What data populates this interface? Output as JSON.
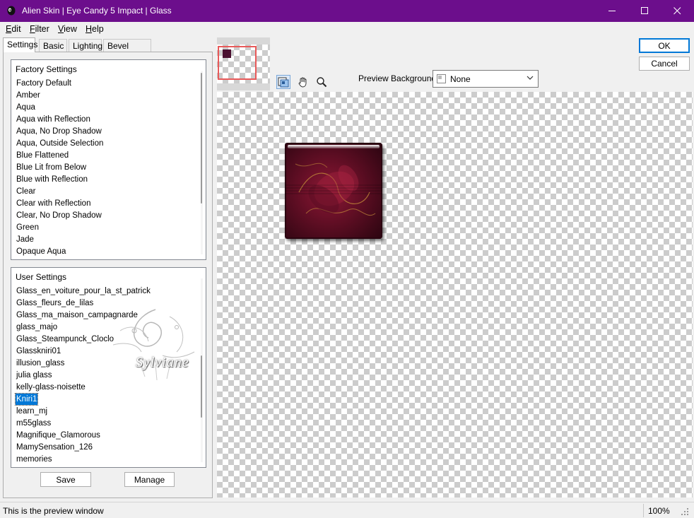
{
  "window": {
    "title": "Alien Skin | Eye Candy 5 Impact | Glass",
    "title_bar_color": "#6c0e8c"
  },
  "menu": [
    "Edit",
    "Filter",
    "View",
    "Help"
  ],
  "tabs": [
    "Settings",
    "Basic",
    "Lighting",
    "Bevel Profile"
  ],
  "active_tab": "Settings",
  "factory_settings": {
    "header": "Factory Settings",
    "items": [
      "Factory Default",
      "Amber",
      "Aqua",
      "Aqua with Reflection",
      "Aqua, No Drop Shadow",
      "Aqua, Outside Selection",
      "Blue Flattened",
      "Blue Lit from Below",
      "Blue with Reflection",
      "Clear",
      "Clear with Reflection",
      "Clear, No Drop Shadow",
      "Green",
      "Jade",
      "Opaque Aqua"
    ]
  },
  "user_settings": {
    "header": "User Settings",
    "items": [
      "Glass_en_voiture_pour_la_st_patrick",
      "Glass_fleurs_de_lilas",
      "Glass_ma_maison_campagnarde",
      "glass_majo",
      "Glass_Steampunck_Cloclo",
      "Glasskniri01",
      "illusion_glass",
      "julia glass",
      "kelly-glass-noisette",
      "Kniri1",
      "learn_mj",
      "m55glass",
      "Magnifique_Glamorous",
      "MamySensation_126",
      "memories"
    ],
    "selected": "Kniri1"
  },
  "buttons": {
    "save": "Save",
    "manage": "Manage",
    "ok": "OK",
    "cancel": "Cancel"
  },
  "preview_background": {
    "label": "Preview Background:",
    "value": "None"
  },
  "watermark_text": "Sylviane",
  "status": {
    "message": "This is the preview window",
    "zoom": "100%"
  },
  "colors": {
    "selection": "#0078d7",
    "tile_dark": "#3d0817",
    "tile_mid": "#8b1a35"
  },
  "icons": {
    "app": "alien-skin-logo-icon",
    "tools": [
      "preview-toggle-icon",
      "hand-pan-icon",
      "zoom-magnifier-icon"
    ]
  }
}
